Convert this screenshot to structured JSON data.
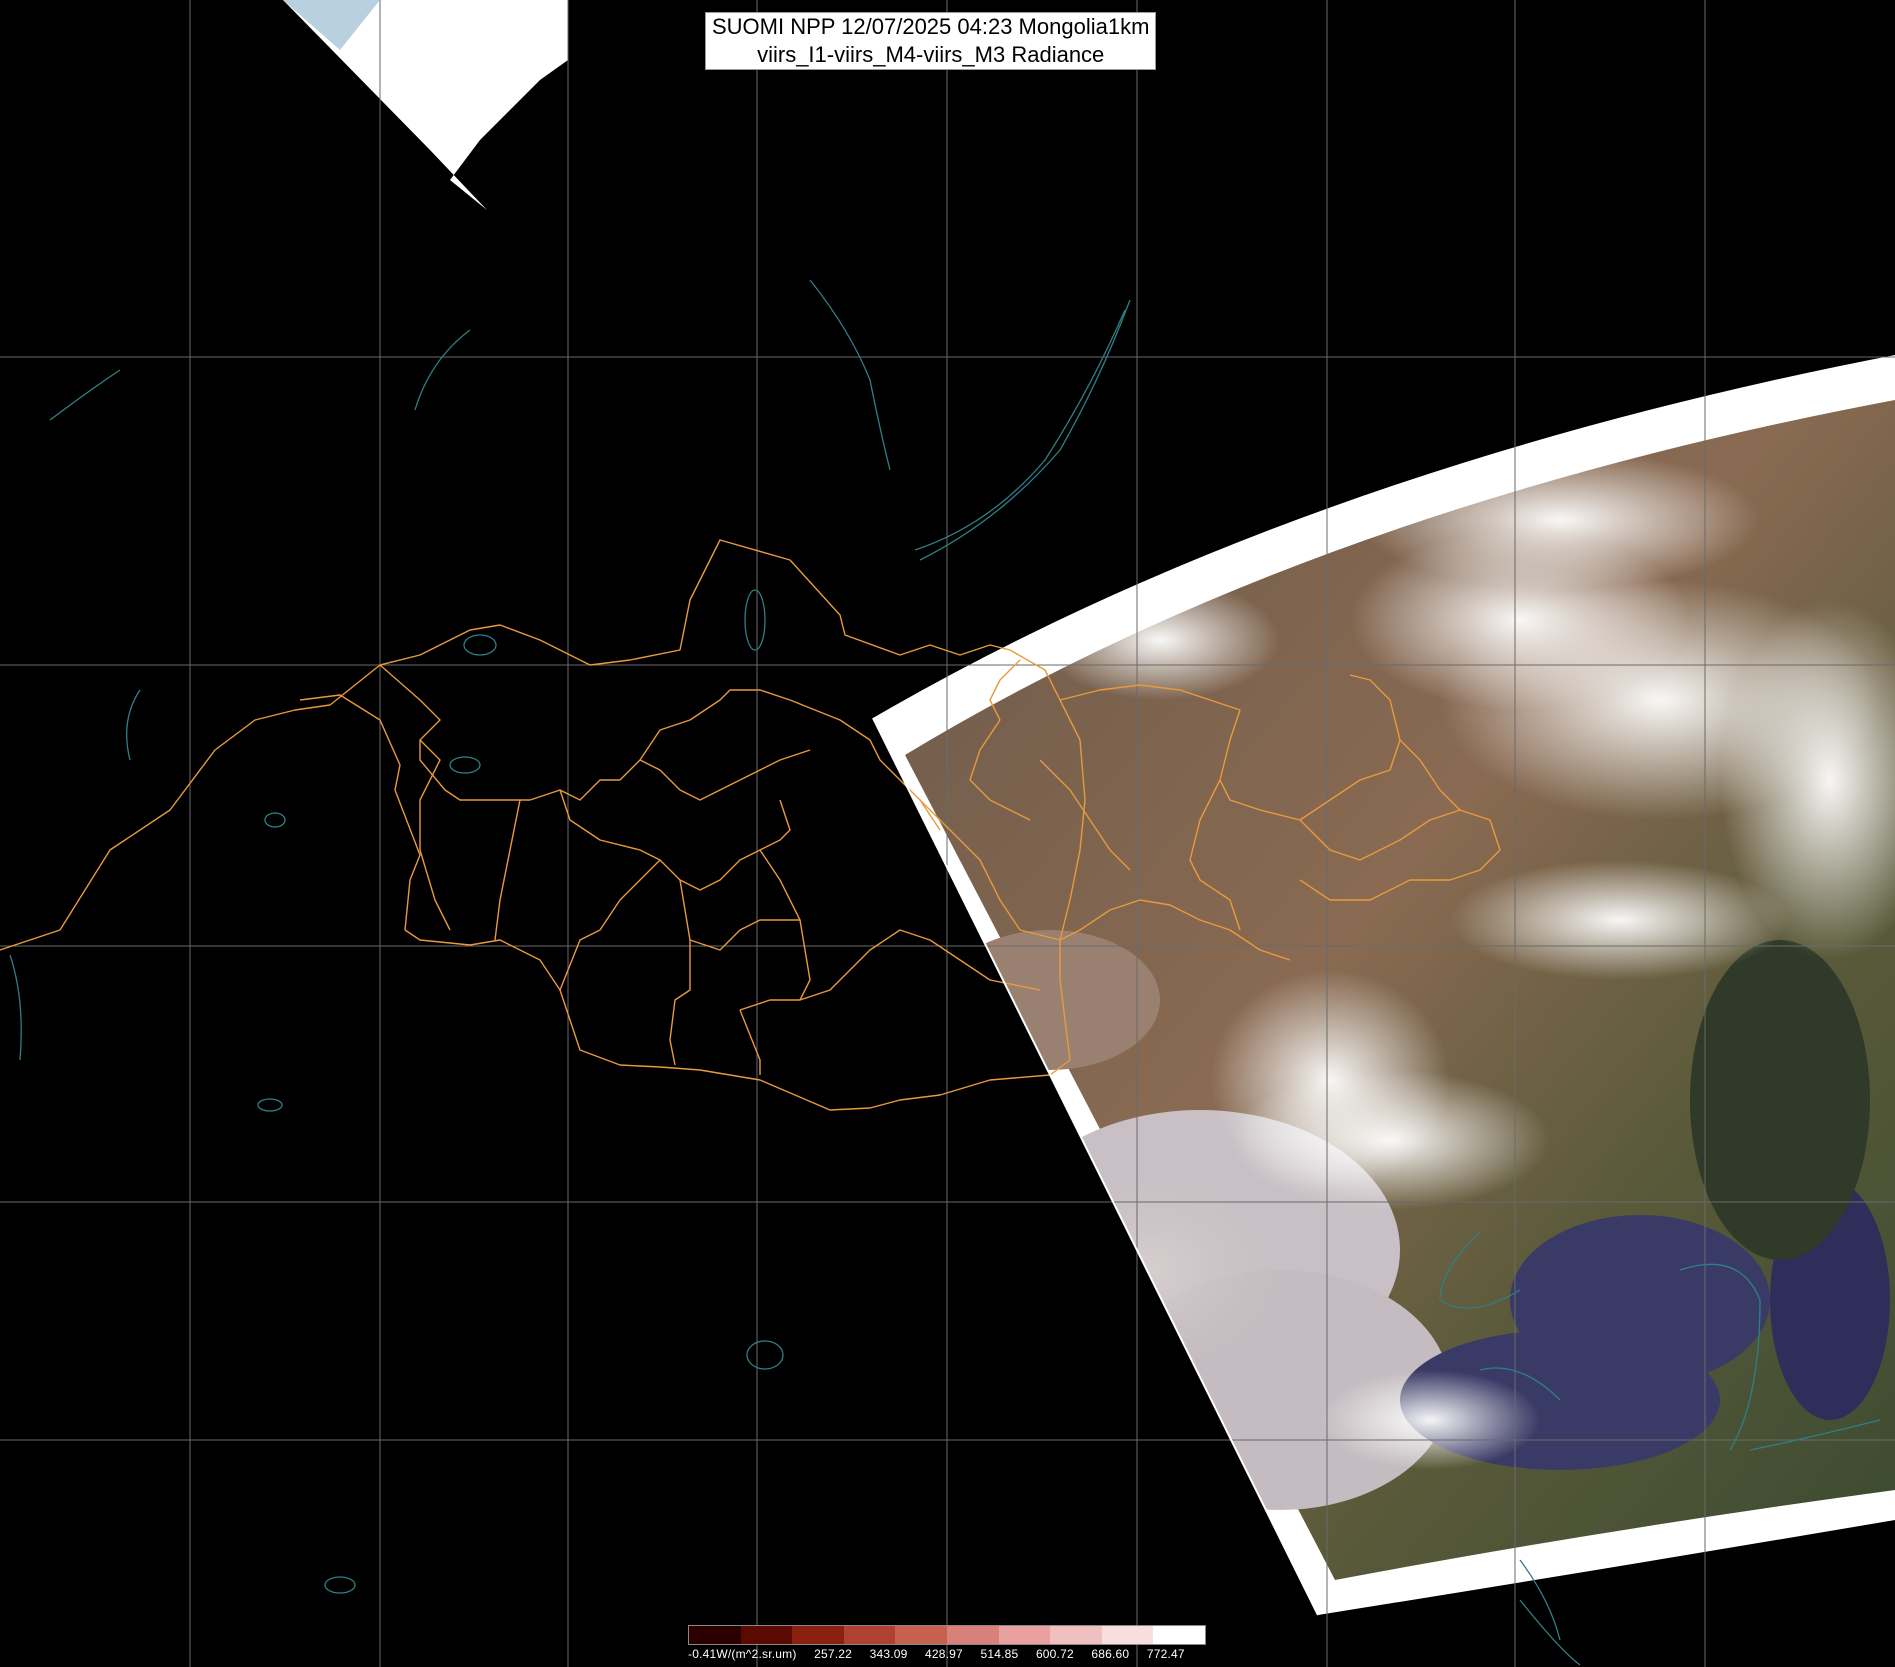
{
  "title": {
    "line1": "SUOMI NPP 12/07/2025 04:23 Mongolia1km",
    "line2": "viirs_I1-viirs_M4-viirs_M3 Radiance"
  },
  "legend": {
    "unit_label": "-0.41W/(m^2.sr.um)",
    "ticks": [
      "257.22",
      "343.09",
      "428.97",
      "514.85",
      "600.72",
      "686.60",
      "772.47"
    ],
    "colors": [
      "#2a0000",
      "#5a0a00",
      "#8a2010",
      "#b04030",
      "#c86050",
      "#d8807a",
      "#e8a0a0",
      "#f0c0c0",
      "#f8dede",
      "#ffffff"
    ]
  },
  "colors": {
    "background": "#000000",
    "border_line": "#e89a3c",
    "coastline": "#2f7f86",
    "grid": "#6a6a6a",
    "swath_edge": "#ffffff"
  }
}
